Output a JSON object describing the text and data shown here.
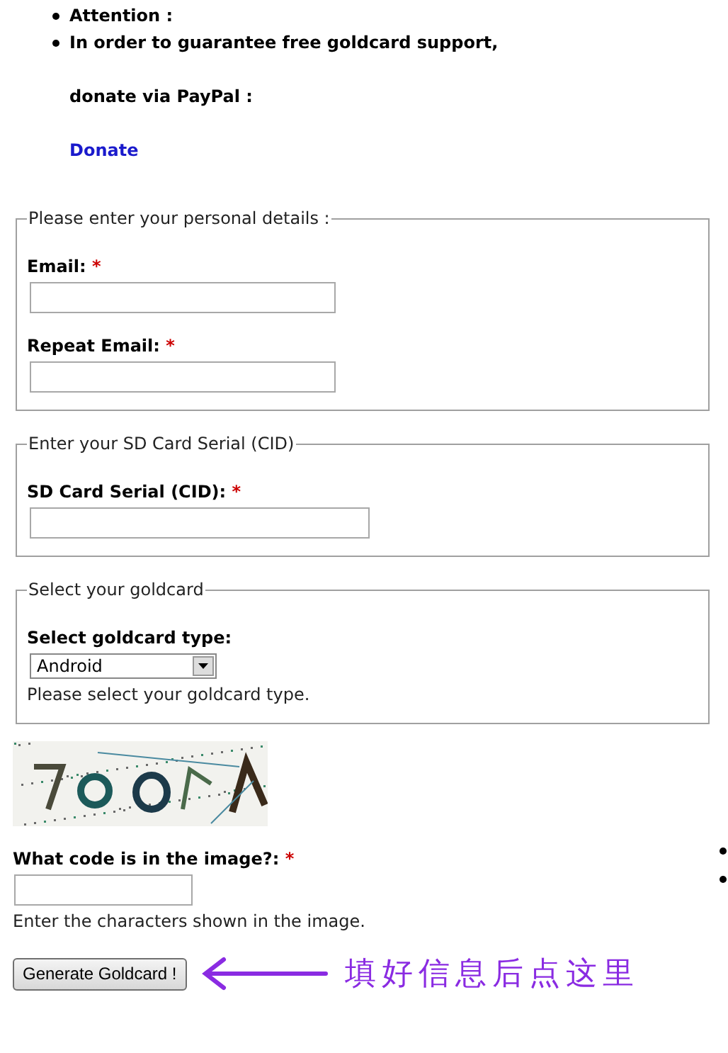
{
  "notices": [
    {
      "text": "Attention :"
    },
    {
      "text": "In order to guarantee free goldcard support,"
    }
  ],
  "donate": {
    "prompt": "donate via PayPal :",
    "link": "Donate"
  },
  "fieldsets": [
    {
      "legend": "Please enter your personal details :",
      "fields": [
        {
          "kind": "text",
          "label": "Email:",
          "required_mark": "*"
        },
        {
          "kind": "text",
          "label": "Repeat Email:",
          "required_mark": "*"
        }
      ]
    },
    {
      "legend": "Enter your SD Card Serial (CID)",
      "fields": [
        {
          "kind": "wide_text",
          "label": "SD Card Serial (CID):",
          "required_mark": "*"
        }
      ]
    },
    {
      "legend": "Select your goldcard",
      "fields": [
        {
          "kind": "select",
          "label": "Select goldcard type:",
          "value": "Android",
          "help": "Please select your goldcard type."
        }
      ]
    }
  ],
  "captcha": {
    "label": "What code is in the image?:",
    "required_mark": "*",
    "help": "Enter the characters shown in the image."
  },
  "side_list": [
    {
      "kind": "bullet"
    },
    {
      "kind": "bullet"
    }
  ],
  "submit": {
    "label": "Generate Goldcard !"
  },
  "annotation": {
    "text": "填好信息后点这里"
  }
}
